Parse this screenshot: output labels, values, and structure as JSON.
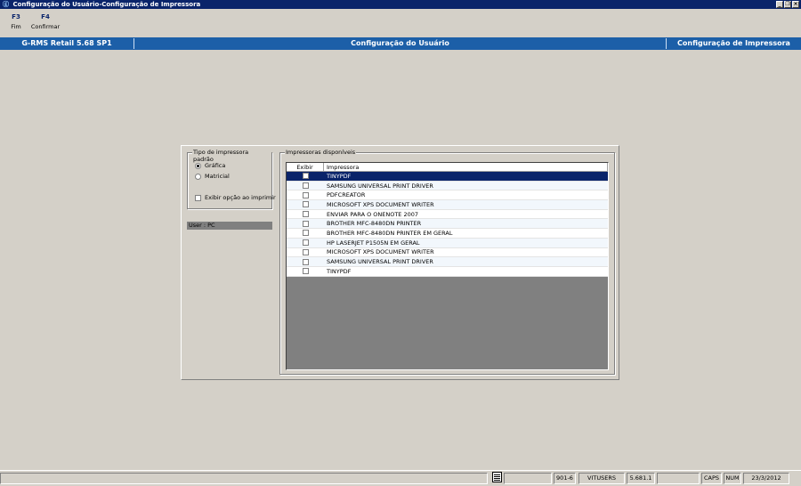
{
  "window": {
    "title": "Configuração do Usuário-Configuração de Impressora"
  },
  "fkeys": [
    {
      "key": "F3",
      "label": "Fim"
    },
    {
      "key": "F4",
      "label": "Confirmar"
    }
  ],
  "header": {
    "product": "G-RMS Retail 5.68 SP1",
    "module": "Configuração do Usuário",
    "screen": "Configuração de Impressora"
  },
  "tipo_group": {
    "legend": "Tipo de impressora padrão",
    "option_grafica": "Gráfica",
    "option_matricial": "Matricial",
    "selected": "Gráfica",
    "exibir_opcao": "Exibir opção ao imprimir",
    "exibir_opcao_checked": false
  },
  "user_label": "User : PC",
  "impressoras": {
    "legend": "Impressoras disponíveis",
    "columns": {
      "exibir": "Exibir",
      "impressora": "Impressora"
    },
    "rows": [
      {
        "name": "TINYPDF",
        "checked": false,
        "selected": true
      },
      {
        "name": "SAMSUNG UNIVERSAL PRINT DRIVER",
        "checked": false
      },
      {
        "name": "PDFCREATOR",
        "checked": false
      },
      {
        "name": "MICROSOFT XPS DOCUMENT WRITER",
        "checked": false
      },
      {
        "name": "ENVIAR PARA O ONENOTE 2007",
        "checked": false
      },
      {
        "name": "BROTHER MFC-8480DN PRINTER",
        "checked": false
      },
      {
        "name": "BROTHER MFC-8480DN PRINTER EM GERAL",
        "checked": false
      },
      {
        "name": "HP LASERJET P1505N EM GERAL",
        "checked": false
      },
      {
        "name": "MICROSOFT XPS DOCUMENT WRITER",
        "checked": false
      },
      {
        "name": "SAMSUNG UNIVERSAL PRINT DRIVER",
        "checked": false
      },
      {
        "name": "TINYPDF",
        "checked": false
      }
    ]
  },
  "statusbar": {
    "code": "901-6",
    "user": "VITUSERS",
    "version": "5.681.1",
    "caps": "CAPS",
    "num": "NUM",
    "date": "23/3/2012"
  },
  "colors": {
    "titlebar": "#0a246a",
    "headerbar": "#1c5fa8",
    "selection": "#0a246a",
    "background": "#d4d0c8"
  }
}
